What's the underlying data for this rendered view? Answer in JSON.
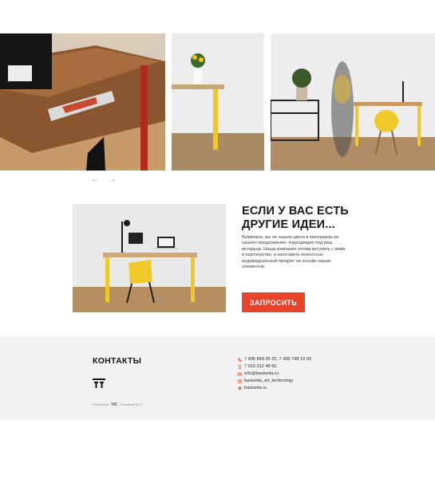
{
  "gallery": {
    "prev_label": "←",
    "next_label": "→"
  },
  "promo": {
    "title": "ЕСЛИ У ВАС ЕСТЬ ДРУГИЕ ИДЕИ...",
    "text": "Возможно, вы не нашли цвета и материалы из нашего предложения, подходящие под ваш интерьер. Наша компания готова вступить с вами в партнерство, и изготовить полностью индивидуальный продукт на основе наших элементов.",
    "button_label": "ЗАПРОСИТЬ"
  },
  "footer": {
    "title": "КОНТАКТЫ",
    "credit_prefix": "Разработка",
    "credit_mark": "WS",
    "credit_suffix": "© Bastarda 2019",
    "contacts": [
      {
        "icon": "phone-icon",
        "text": "7 495 849 25 25, 7 495 748 19 09"
      },
      {
        "icon": "mobile-icon",
        "text": "7 915 312 48 65"
      },
      {
        "icon": "mail-icon",
        "text": "info@bastarda.ru"
      },
      {
        "icon": "instagram-icon",
        "text": "bastarda_art_technology"
      },
      {
        "icon": "location-icon",
        "text": "bastarda.ru"
      }
    ]
  },
  "colors": {
    "accent": "#e9432c",
    "footer_bg": "#f1f1f1",
    "table_yellow": "#f0c929"
  }
}
